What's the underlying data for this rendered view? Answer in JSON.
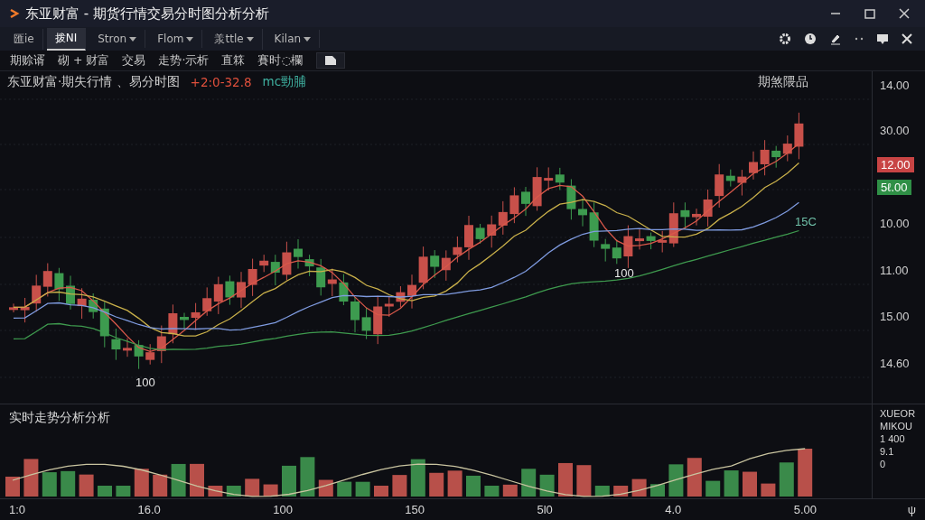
{
  "window": {
    "title": "东亚财富 - 期货行情交易分时图分析分析"
  },
  "menu": [
    {
      "label": "匯ie",
      "selected": false,
      "dropdown": false
    },
    {
      "label": "拨NI",
      "selected": true,
      "dropdown": false
    },
    {
      "label": "Stron",
      "selected": false,
      "dropdown": true
    },
    {
      "label": "Flom",
      "selected": false,
      "dropdown": true
    },
    {
      "label": "羕ttle",
      "selected": false,
      "dropdown": true
    },
    {
      "label": "Kilan",
      "selected": false,
      "dropdown": true
    }
  ],
  "toolbar": [
    "期赊谞",
    "砌 + 财富",
    "交易",
    "走势·示析",
    "直箖",
    "賽时◌欄"
  ],
  "chart": {
    "title": "东亚财富·期失行情 、易分时图",
    "indicators": [
      {
        "text": "+2:0-32.8",
        "color": "#e0503c"
      },
      {
        "text": "mc勁脯",
        "color": "#3fb0a0"
      }
    ],
    "label": "期煞隈品",
    "axis": [
      {
        "text": "14.00",
        "kind": "tick"
      },
      {
        "text": "30.00",
        "kind": "tick"
      },
      {
        "text": "12.00",
        "kind": "tag",
        "color": "#c84444"
      },
      {
        "text": "5ℓ.00",
        "kind": "tag",
        "color": "#2f8f46"
      },
      {
        "text": "10.00",
        "kind": "tick"
      },
      {
        "text": "11.00",
        "kind": "tick"
      },
      {
        "text": "15.00",
        "kind": "tick"
      },
      {
        "text": "14.60",
        "kind": "tick"
      }
    ],
    "annotations": [
      "100",
      "100",
      "15C"
    ]
  },
  "volume": {
    "title": "实时走势分析分析",
    "axis": [
      "XUEOR",
      "MIKOU",
      "1 400",
      "9.1",
      "0"
    ],
    "xaxis": [
      "1:0",
      "16.0",
      "100",
      "150",
      "5l0",
      "4.0",
      "5.00"
    ],
    "corner": "ψ"
  }
}
